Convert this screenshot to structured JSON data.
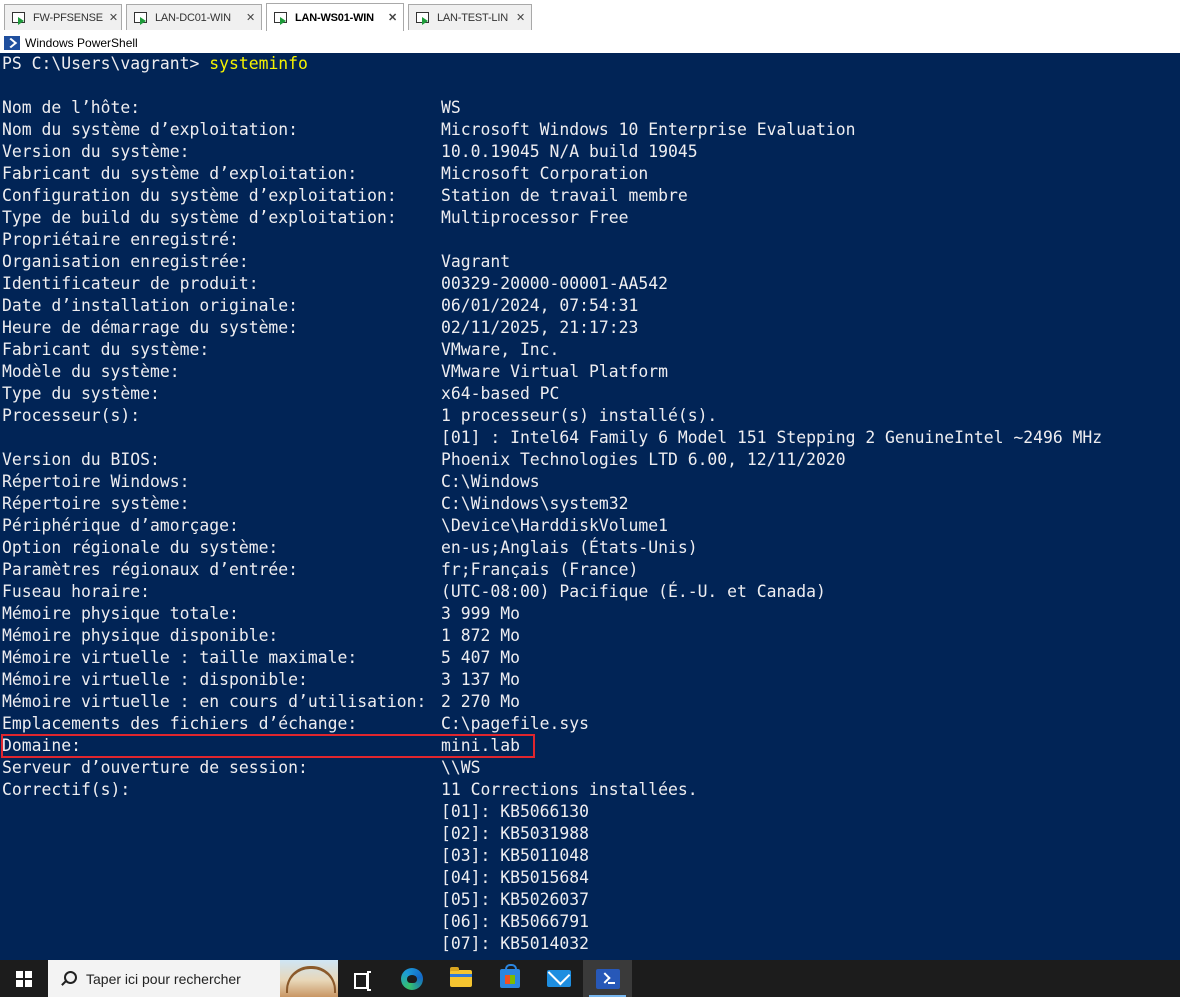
{
  "vm_tabs": [
    {
      "label": "FW-PFSENSE",
      "active": false
    },
    {
      "label": "LAN-DC01-WIN",
      "active": false
    },
    {
      "label": "LAN-WS01-WIN",
      "active": true
    },
    {
      "label": "LAN-TEST-LIN",
      "active": false
    }
  ],
  "tab_close_glyph": "✕",
  "window": {
    "title": "Windows PowerShell"
  },
  "console": {
    "prompt": "PS C:\\Users\\vagrant> ",
    "command": "systeminfo",
    "rows": [
      {
        "key": "Nom de l’hôte:",
        "value": "WS"
      },
      {
        "key": "Nom du système d’exploitation:",
        "value": "Microsoft Windows 10 Enterprise Evaluation"
      },
      {
        "key": "Version du système:",
        "value": "10.0.19045 N/A build 19045"
      },
      {
        "key": "Fabricant du système d’exploitation:",
        "value": "Microsoft Corporation"
      },
      {
        "key": "Configuration du système d’exploitation:",
        "value": "Station de travail membre"
      },
      {
        "key": "Type de build du système d’exploitation:",
        "value": "Multiprocessor Free"
      },
      {
        "key": "Propriétaire enregistré:",
        "value": ""
      },
      {
        "key": "Organisation enregistrée:",
        "value": "Vagrant"
      },
      {
        "key": "Identificateur de produit:",
        "value": "00329-20000-00001-AA542"
      },
      {
        "key": "Date d’installation originale:",
        "value": "06/01/2024, 07:54:31"
      },
      {
        "key": "Heure de démarrage du système:",
        "value": "02/11/2025, 21:17:23"
      },
      {
        "key": "Fabricant du système:",
        "value": "VMware, Inc."
      },
      {
        "key": "Modèle du système:",
        "value": "VMware Virtual Platform"
      },
      {
        "key": "Type du système:",
        "value": "x64-based PC"
      },
      {
        "key": "Processeur(s):",
        "value": "1 processeur(s) installé(s)."
      },
      {
        "key": "",
        "value": "[01] : Intel64 Family 6 Model 151 Stepping 2 GenuineIntel ~2496 MHz"
      },
      {
        "key": "Version du BIOS:",
        "value": "Phoenix Technologies LTD 6.00, 12/11/2020"
      },
      {
        "key": "Répertoire Windows:",
        "value": "C:\\Windows"
      },
      {
        "key": "Répertoire système:",
        "value": "C:\\Windows\\system32"
      },
      {
        "key": "Périphérique d’amorçage:",
        "value": "\\Device\\HarddiskVolume1"
      },
      {
        "key": "Option régionale du système:",
        "value": "en-us;Anglais (États-Unis)"
      },
      {
        "key": "Paramètres régionaux d’entrée:",
        "value": "fr;Français (France)"
      },
      {
        "key": "Fuseau horaire:",
        "value": "(UTC-08:00) Pacifique (É.-U. et Canada)"
      },
      {
        "key": "Mémoire physique totale:",
        "value": "3 999 Mo"
      },
      {
        "key": "Mémoire physique disponible:",
        "value": "1 872 Mo"
      },
      {
        "key": "Mémoire virtuelle : taille maximale:",
        "value": "5 407 Mo"
      },
      {
        "key": "Mémoire virtuelle : disponible:",
        "value": "3 137 Mo"
      },
      {
        "key": "Mémoire virtuelle : en cours d’utilisation:",
        "value": "2 270 Mo"
      },
      {
        "key": "Emplacements des fichiers d’échange:",
        "value": "C:\\pagefile.sys"
      },
      {
        "key": "Domaine:",
        "value": "mini.lab"
      },
      {
        "key": "Serveur d’ouverture de session:",
        "value": "\\\\WS"
      },
      {
        "key": "Correctif(s):",
        "value": "11 Corrections installées."
      },
      {
        "key": "",
        "value": "[01]: KB5066130"
      },
      {
        "key": "",
        "value": "[02]: KB5031988"
      },
      {
        "key": "",
        "value": "[03]: KB5011048"
      },
      {
        "key": "",
        "value": "[04]: KB5015684"
      },
      {
        "key": "",
        "value": "[05]: KB5026037"
      },
      {
        "key": "",
        "value": "[06]: KB5066791"
      },
      {
        "key": "",
        "value": "[07]: KB5014032"
      }
    ]
  },
  "taskbar": {
    "search_placeholder": "Taper ici pour rechercher",
    "apps": [
      {
        "icon": "task-view-icon"
      },
      {
        "icon": "edge-icon"
      },
      {
        "icon": "file-explorer-icon"
      },
      {
        "icon": "store-icon"
      },
      {
        "icon": "mail-icon"
      },
      {
        "icon": "powershell-icon",
        "active": true
      }
    ]
  },
  "colors": {
    "console_bg": "#012456",
    "console_fg": "#eeedf0",
    "command_fg": "#f5f200",
    "highlight_border": "#e0262e"
  }
}
